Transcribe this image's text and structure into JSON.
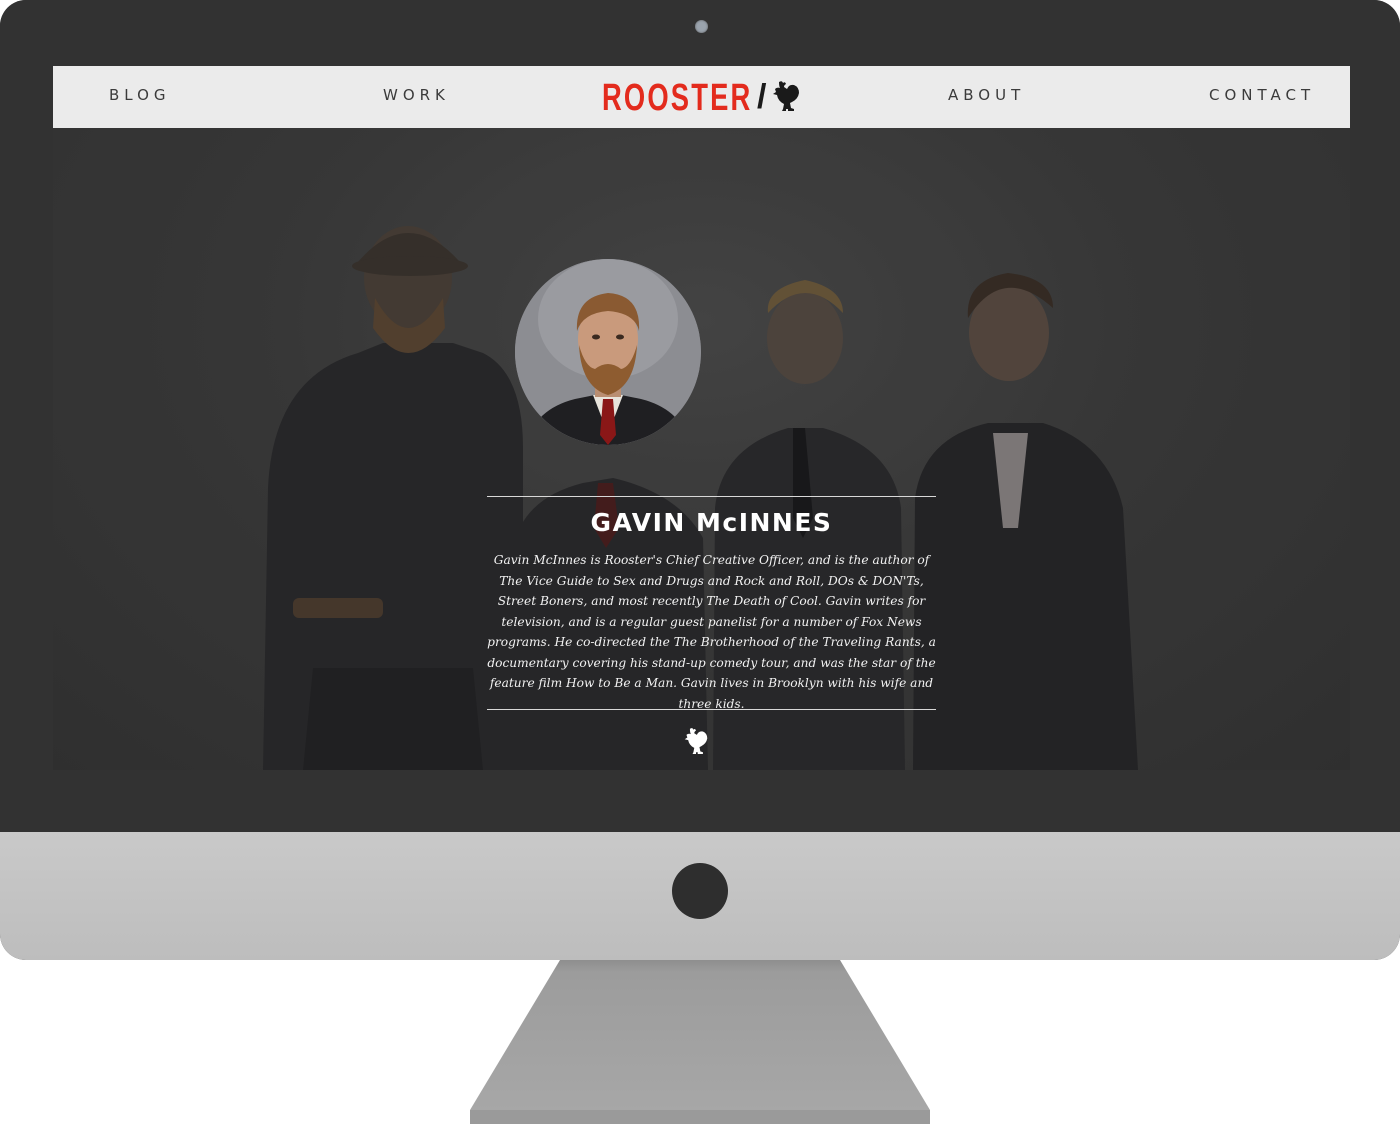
{
  "nav": {
    "links": [
      {
        "label": "BLOG"
      },
      {
        "label": "WORK"
      },
      {
        "label": "ABOUT"
      },
      {
        "label": "CONTACT"
      }
    ],
    "logo_text": "ROOSTER",
    "logo_slash": "/"
  },
  "profile": {
    "name": "GAVIN McINNES",
    "bio": "Gavin McInnes is Rooster's Chief Creative Officer, and is the author of The Vice Guide to Sex and Drugs and Rock and Roll, DOs & DON'Ts, Street Boners, and most recently The Death of Cool. Gavin writes for television, and is a regular guest panelist for a number of Fox News programs. He co-directed the The Brotherhood of the Traveling Rants, a documentary covering his stand-up comedy tour, and was the star of the feature film How to Be a Man. Gavin lives in Brooklyn with his wife and three kids."
  },
  "colors": {
    "brand_red": "#e32b1d",
    "nav_bg": "#ebebeb",
    "screen_bg": "#3a3a3a",
    "bezel": "#323232",
    "chin": "#c4c4c4"
  },
  "icons": {
    "logo": "rooster-icon",
    "footer": "rooster-icon"
  }
}
